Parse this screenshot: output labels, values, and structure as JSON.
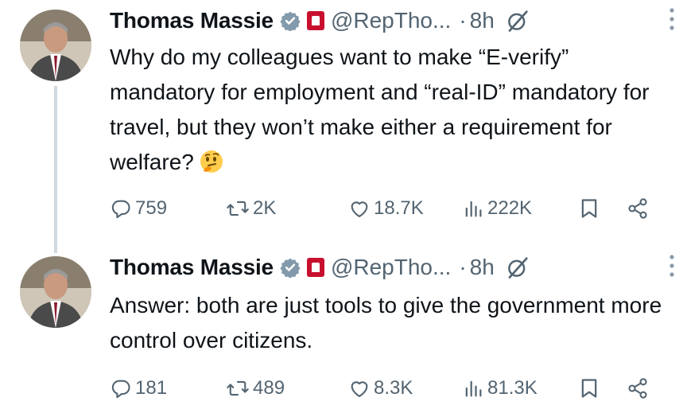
{
  "thread": [
    {
      "author": {
        "name": "Thomas Massie",
        "handle": "@RepTho...",
        "time": "8h",
        "separator": "·"
      },
      "text": "Why do my colleagues want to make “E-verify” mandatory for employment and “real-ID” mandatory for travel, but they won’t make either a requirement for welfare?",
      "emoji": "thinking-face",
      "stats": {
        "replies": "759",
        "reposts": "2K",
        "likes": "18.7K",
        "views": "222K"
      }
    },
    {
      "author": {
        "name": "Thomas Massie",
        "handle": "@RepTho...",
        "time": "8h",
        "separator": "·"
      },
      "text": "Answer: both are just tools to give the government more control over citizens.",
      "stats": {
        "replies": "181",
        "reposts": "489",
        "likes": "8.3K",
        "views": "81.3K"
      }
    }
  ],
  "colors": {
    "text": "#0f1419",
    "muted": "#536471",
    "verified_badge": "#829aab",
    "flag_red": "#c8102e",
    "thread_line": "#cfd9de"
  }
}
